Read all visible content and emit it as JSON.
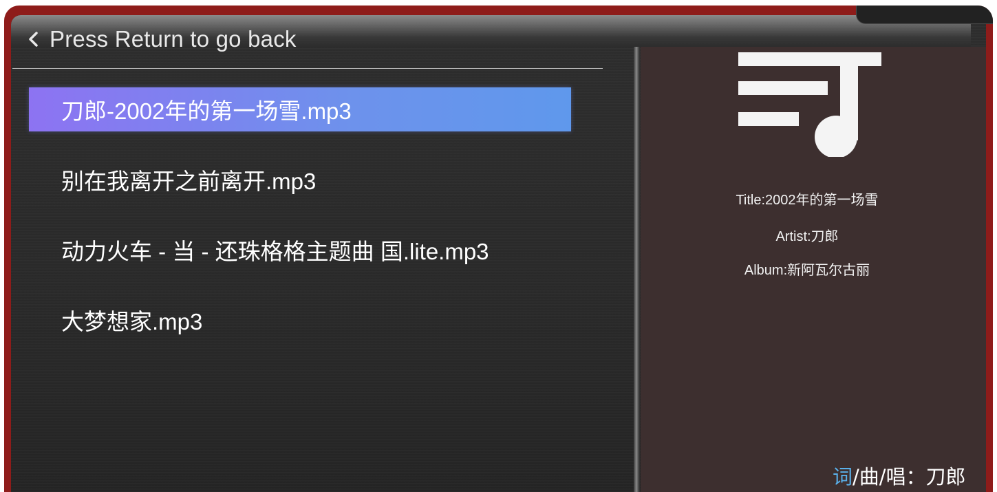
{
  "header": {
    "back_label": "Press Return to go back"
  },
  "playlist": {
    "items": [
      {
        "label": "刀郎-2002年的第一场雪.mp3",
        "selected": true
      },
      {
        "label": "别在我离开之前离开.mp3",
        "selected": false
      },
      {
        "label": "动力火车 - 当 - 还珠格格主题曲 国.lite.mp3",
        "selected": false
      },
      {
        "label": "大梦想家.mp3",
        "selected": false
      }
    ]
  },
  "now_playing": {
    "icon": "music-playlist-icon",
    "title": "Title:2002年的第一场雪",
    "artist": "Artist:刀郎",
    "album": "Album:新阿瓦尔古丽"
  },
  "lyric_overlay": {
    "lead": "词",
    "rest": "/曲/唱：刀郎"
  },
  "colors": {
    "frame": "#8e1c1a",
    "selection_start": "#8d73f2",
    "selection_end": "#5f98ec",
    "lyric_accent": "#5ab0ea"
  }
}
